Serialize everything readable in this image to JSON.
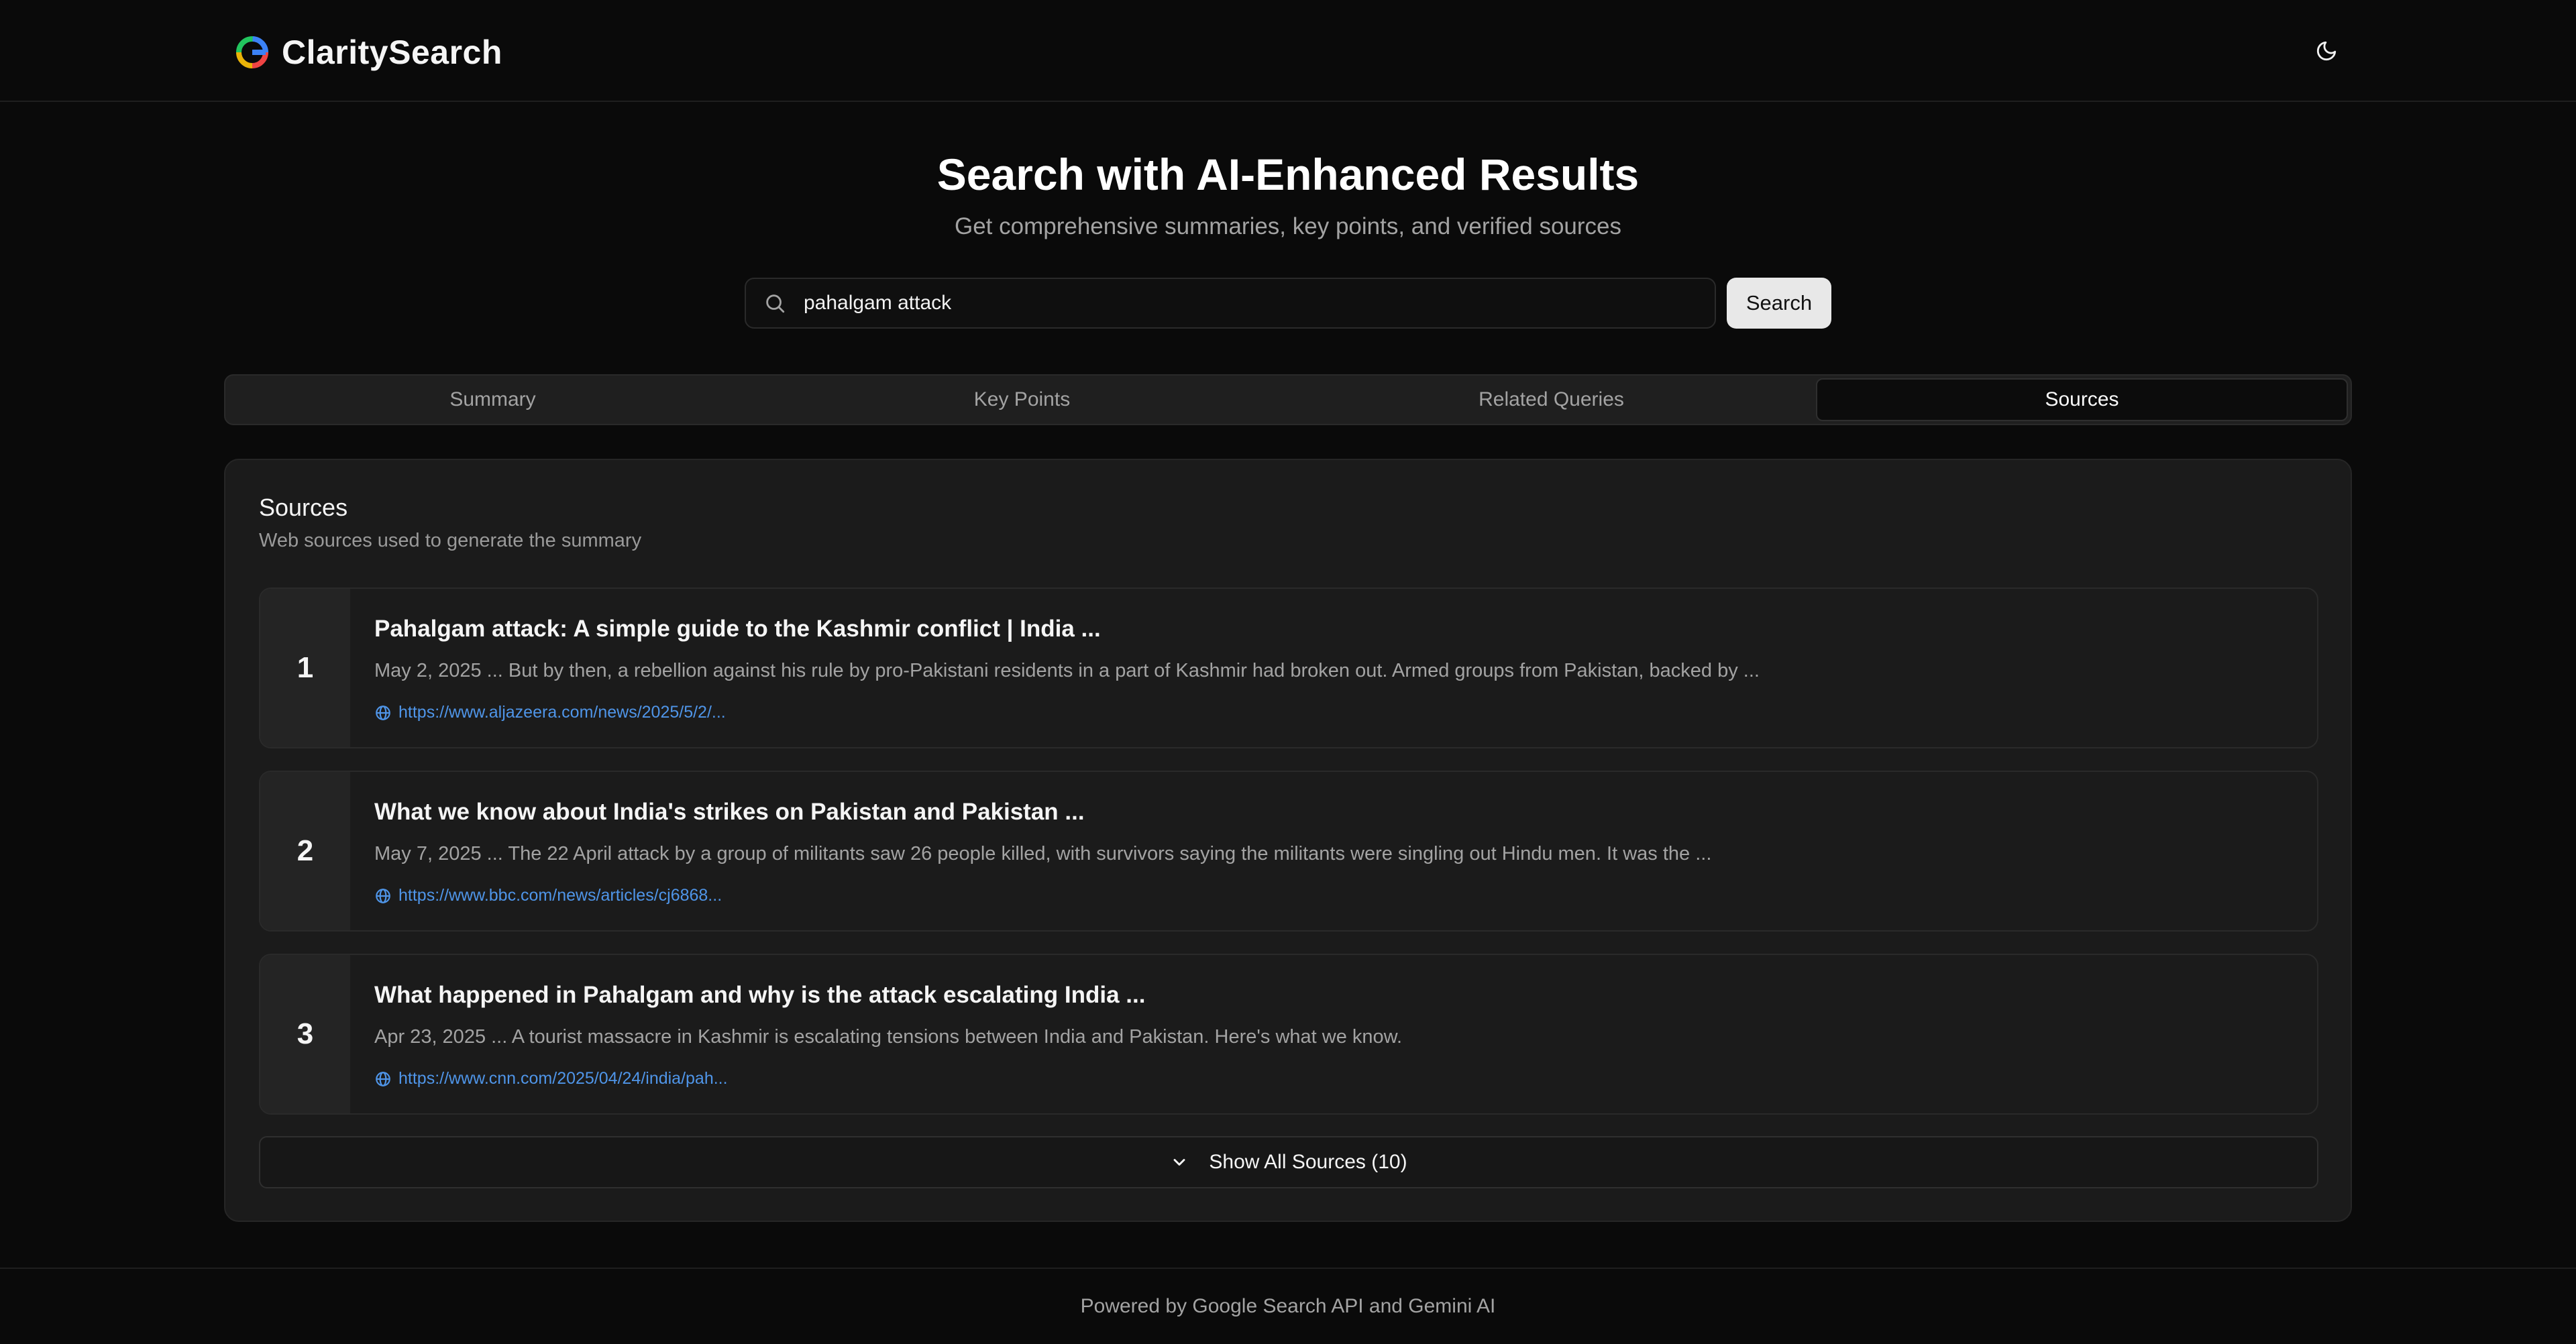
{
  "app": {
    "name": "ClaritySearch",
    "accent": "#4f95e8"
  },
  "header": {
    "theme_toggle_icon": "moon-icon"
  },
  "hero": {
    "title": "Search with AI-Enhanced Results",
    "subtitle": "Get comprehensive summaries, key points, and verified sources"
  },
  "search": {
    "value": "pahalgam attack",
    "button_label": "Search"
  },
  "tabs": [
    {
      "label": "Summary",
      "active": false
    },
    {
      "label": "Key Points",
      "active": false
    },
    {
      "label": "Related Queries",
      "active": false
    },
    {
      "label": "Sources",
      "active": true
    }
  ],
  "sources_panel": {
    "title": "Sources",
    "subtitle": "Web sources used to generate the summary",
    "items": [
      {
        "number": "1",
        "title": "Pahalgam attack: A simple guide to the Kashmir conflict | India ...",
        "snippet": "May 2, 2025 ... But by then, a rebellion against his rule by pro-Pakistani residents in a part of Kashmir had broken out. Armed groups from Pakistan, backed by ...",
        "url": "https://www.aljazeera.com/news/2025/5/2/..."
      },
      {
        "number": "2",
        "title": "What we know about India's strikes on Pakistan and Pakistan ...",
        "snippet": "May 7, 2025 ... The 22 April attack by a group of militants saw 26 people killed, with survivors saying the militants were singling out Hindu men. It was the ...",
        "url": "https://www.bbc.com/news/articles/cj6868..."
      },
      {
        "number": "3",
        "title": "What happened in Pahalgam and why is the attack escalating India ...",
        "snippet": "Apr 23, 2025 ... A tourist massacre in Kashmir is escalating tensions between India and Pakistan. Here's what we know.",
        "url": "https://www.cnn.com/2025/04/24/india/pah..."
      }
    ],
    "show_all_label": "Show All Sources (10)"
  },
  "footer": {
    "text": "Powered by Google Search API and Gemini AI"
  }
}
